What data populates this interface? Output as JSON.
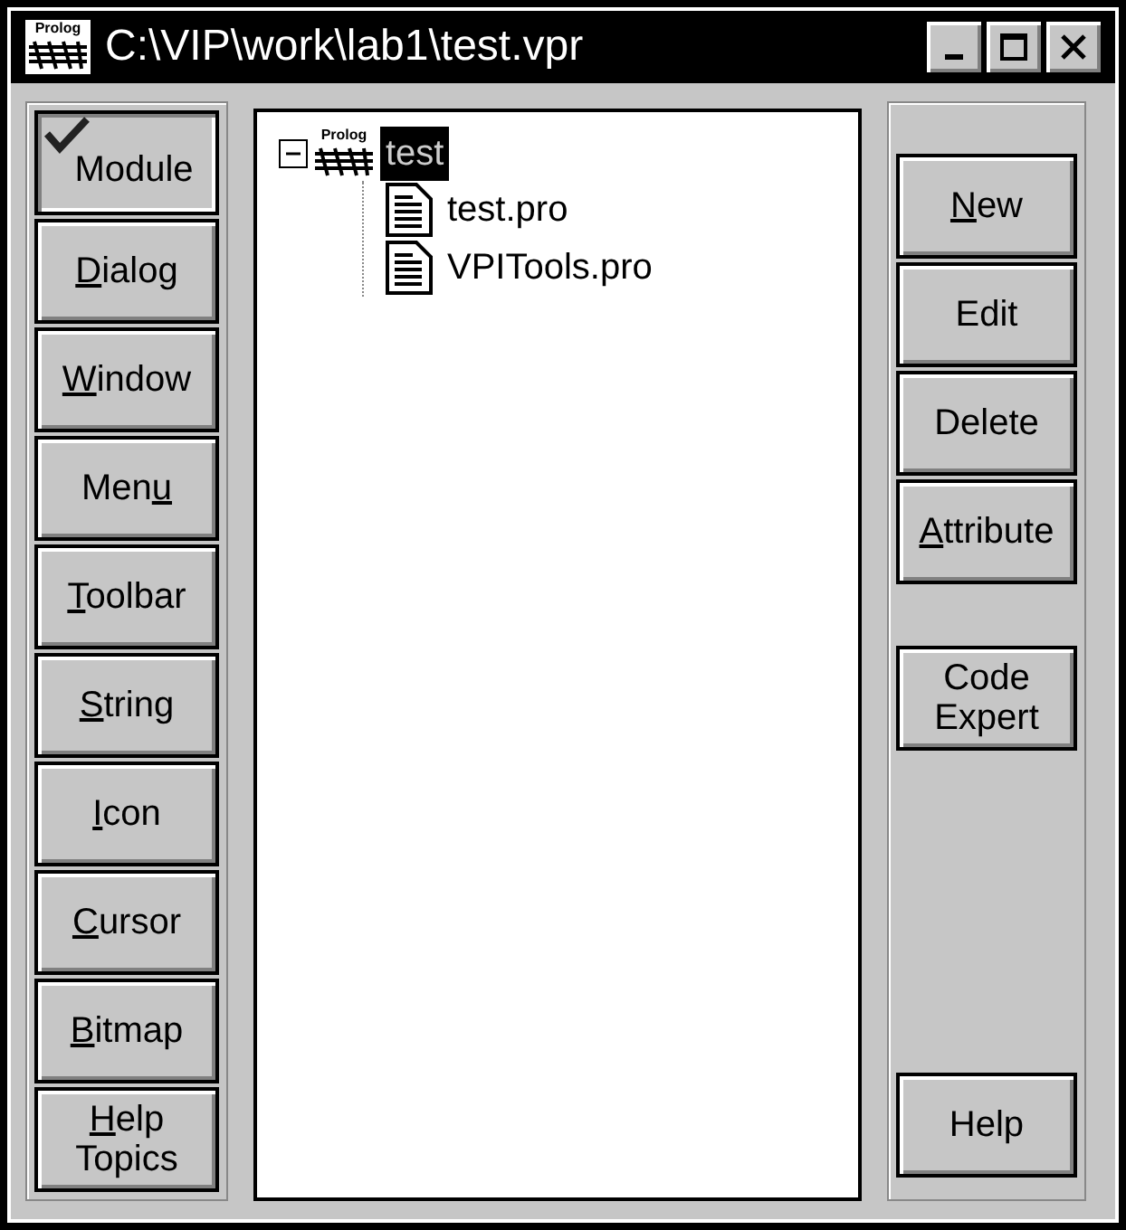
{
  "window": {
    "title": "C:\\VIP\\work\\lab1\\test.vpr",
    "icon_text": "Prolog"
  },
  "left_buttons": [
    {
      "label": {
        "post": "Module"
      },
      "selected": true
    },
    {
      "label": {
        "key": "D",
        "post": "ialog"
      },
      "selected": false
    },
    {
      "label": {
        "key": "W",
        "post": "indow"
      },
      "selected": false
    },
    {
      "label": {
        "pre": "Men",
        "key": "u"
      },
      "selected": false
    },
    {
      "label": {
        "key": "T",
        "post": "oolbar"
      },
      "selected": false
    },
    {
      "label": {
        "key": "S",
        "post": "tring"
      },
      "selected": false
    },
    {
      "label": {
        "key": "I",
        "post": "con"
      },
      "selected": false
    },
    {
      "label": {
        "key": "C",
        "post": "ursor"
      },
      "selected": false
    },
    {
      "label": {
        "key": "B",
        "post": "itmap"
      },
      "selected": false
    },
    {
      "label": {
        "key": "H",
        "post": "elp Topics"
      },
      "selected": false
    }
  ],
  "tree": {
    "root": {
      "label": "test",
      "icon_text": "Prolog",
      "selected": true,
      "expanded": true,
      "children": [
        {
          "label": "test.pro"
        },
        {
          "label": "VPITools.pro"
        }
      ]
    }
  },
  "right_buttons": [
    {
      "label": {
        "key": "N",
        "post": "ew"
      }
    },
    {
      "label": {
        "post": "Edit"
      }
    },
    {
      "label": {
        "post": "Delete"
      }
    },
    {
      "label": {
        "key": "A",
        "post": "ttribute"
      }
    },
    {
      "label": {
        "post": "Code Expert"
      }
    }
  ],
  "help_button": {
    "label": {
      "post": "Help"
    }
  }
}
